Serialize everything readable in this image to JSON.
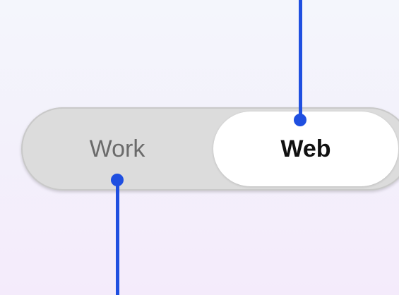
{
  "segmented_control": {
    "options": [
      {
        "label": "Work",
        "selected": false
      },
      {
        "label": "Web",
        "selected": true
      }
    ]
  },
  "colors": {
    "callout_blue": "#1f4fe0",
    "track_gray": "#dcdcdc",
    "selected_white": "#ffffff"
  }
}
